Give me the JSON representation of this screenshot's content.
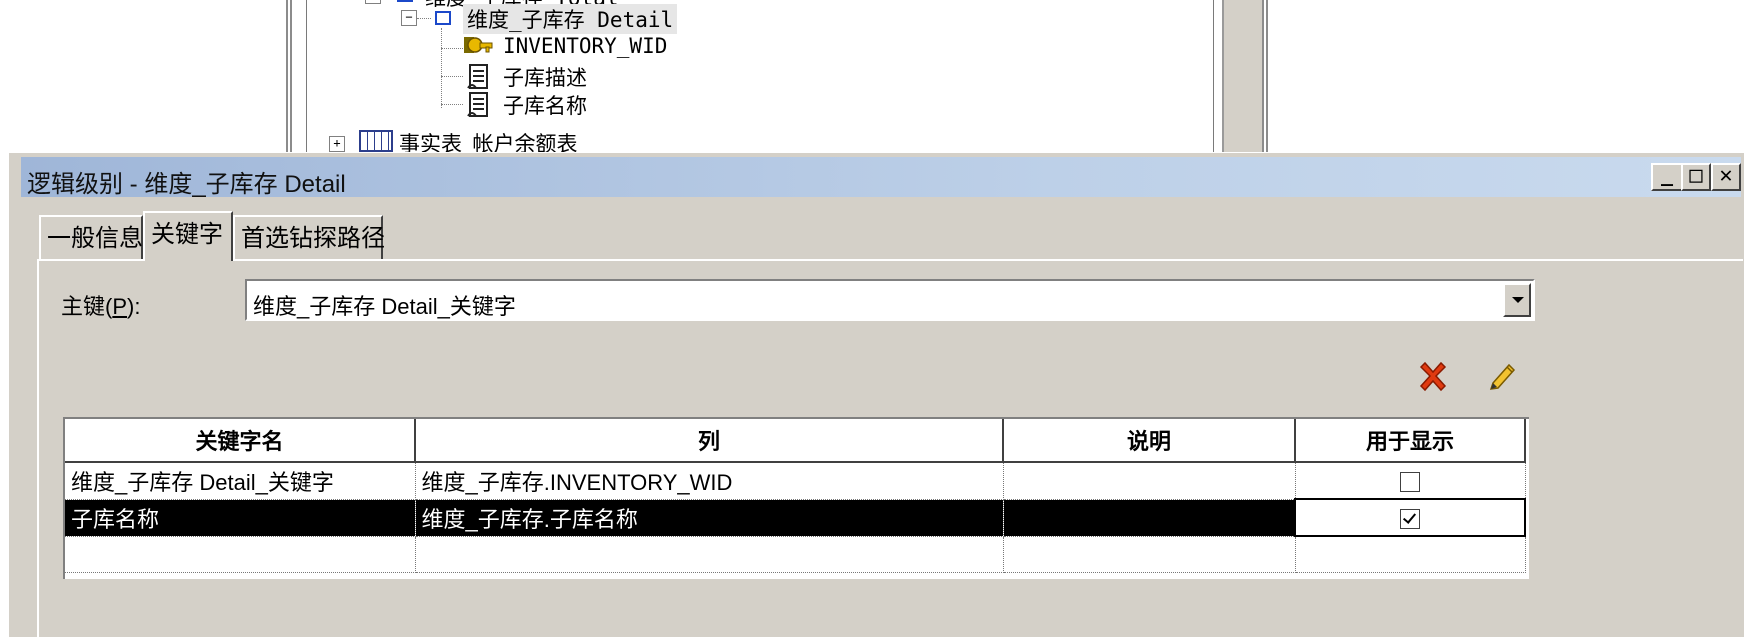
{
  "tree": {
    "nodes": [
      {
        "label": "维度_子库存 Total"
      },
      {
        "label": "维度_子库存 Detail"
      },
      {
        "label": "INVENTORY_WID"
      },
      {
        "label": "子库描述"
      },
      {
        "label": "子库名称"
      },
      {
        "label": "事实表_帐户余额表"
      }
    ],
    "expander_collapse": "−",
    "expander_expand": "+"
  },
  "dialog": {
    "title": "逻辑级别 - 维度_子库存 Detail",
    "buttons": {
      "minimize": "_",
      "maximize": "□",
      "close": "✕"
    },
    "tabs": [
      {
        "label": "一般信息"
      },
      {
        "label": "关键字"
      },
      {
        "label": "首选钻探路径"
      }
    ],
    "primary_key": {
      "label_prefix": "主键(",
      "label_mnemonic": "P",
      "label_suffix": "):",
      "value": "维度_子库存 Detail_关键字"
    },
    "toolbar": {
      "delete_icon": "delete-icon",
      "edit_icon": "pencil-icon"
    },
    "grid": {
      "headers": [
        "关键字名",
        "列",
        "说明",
        "用于显示"
      ],
      "rows": [
        {
          "name": "维度_子库存 Detail_关键字",
          "column": "维度_子库存.INVENTORY_WID",
          "desc": "",
          "display": false
        },
        {
          "name": "子库名称",
          "column": "维度_子库存.子库名称",
          "desc": "",
          "display": true
        }
      ]
    }
  }
}
